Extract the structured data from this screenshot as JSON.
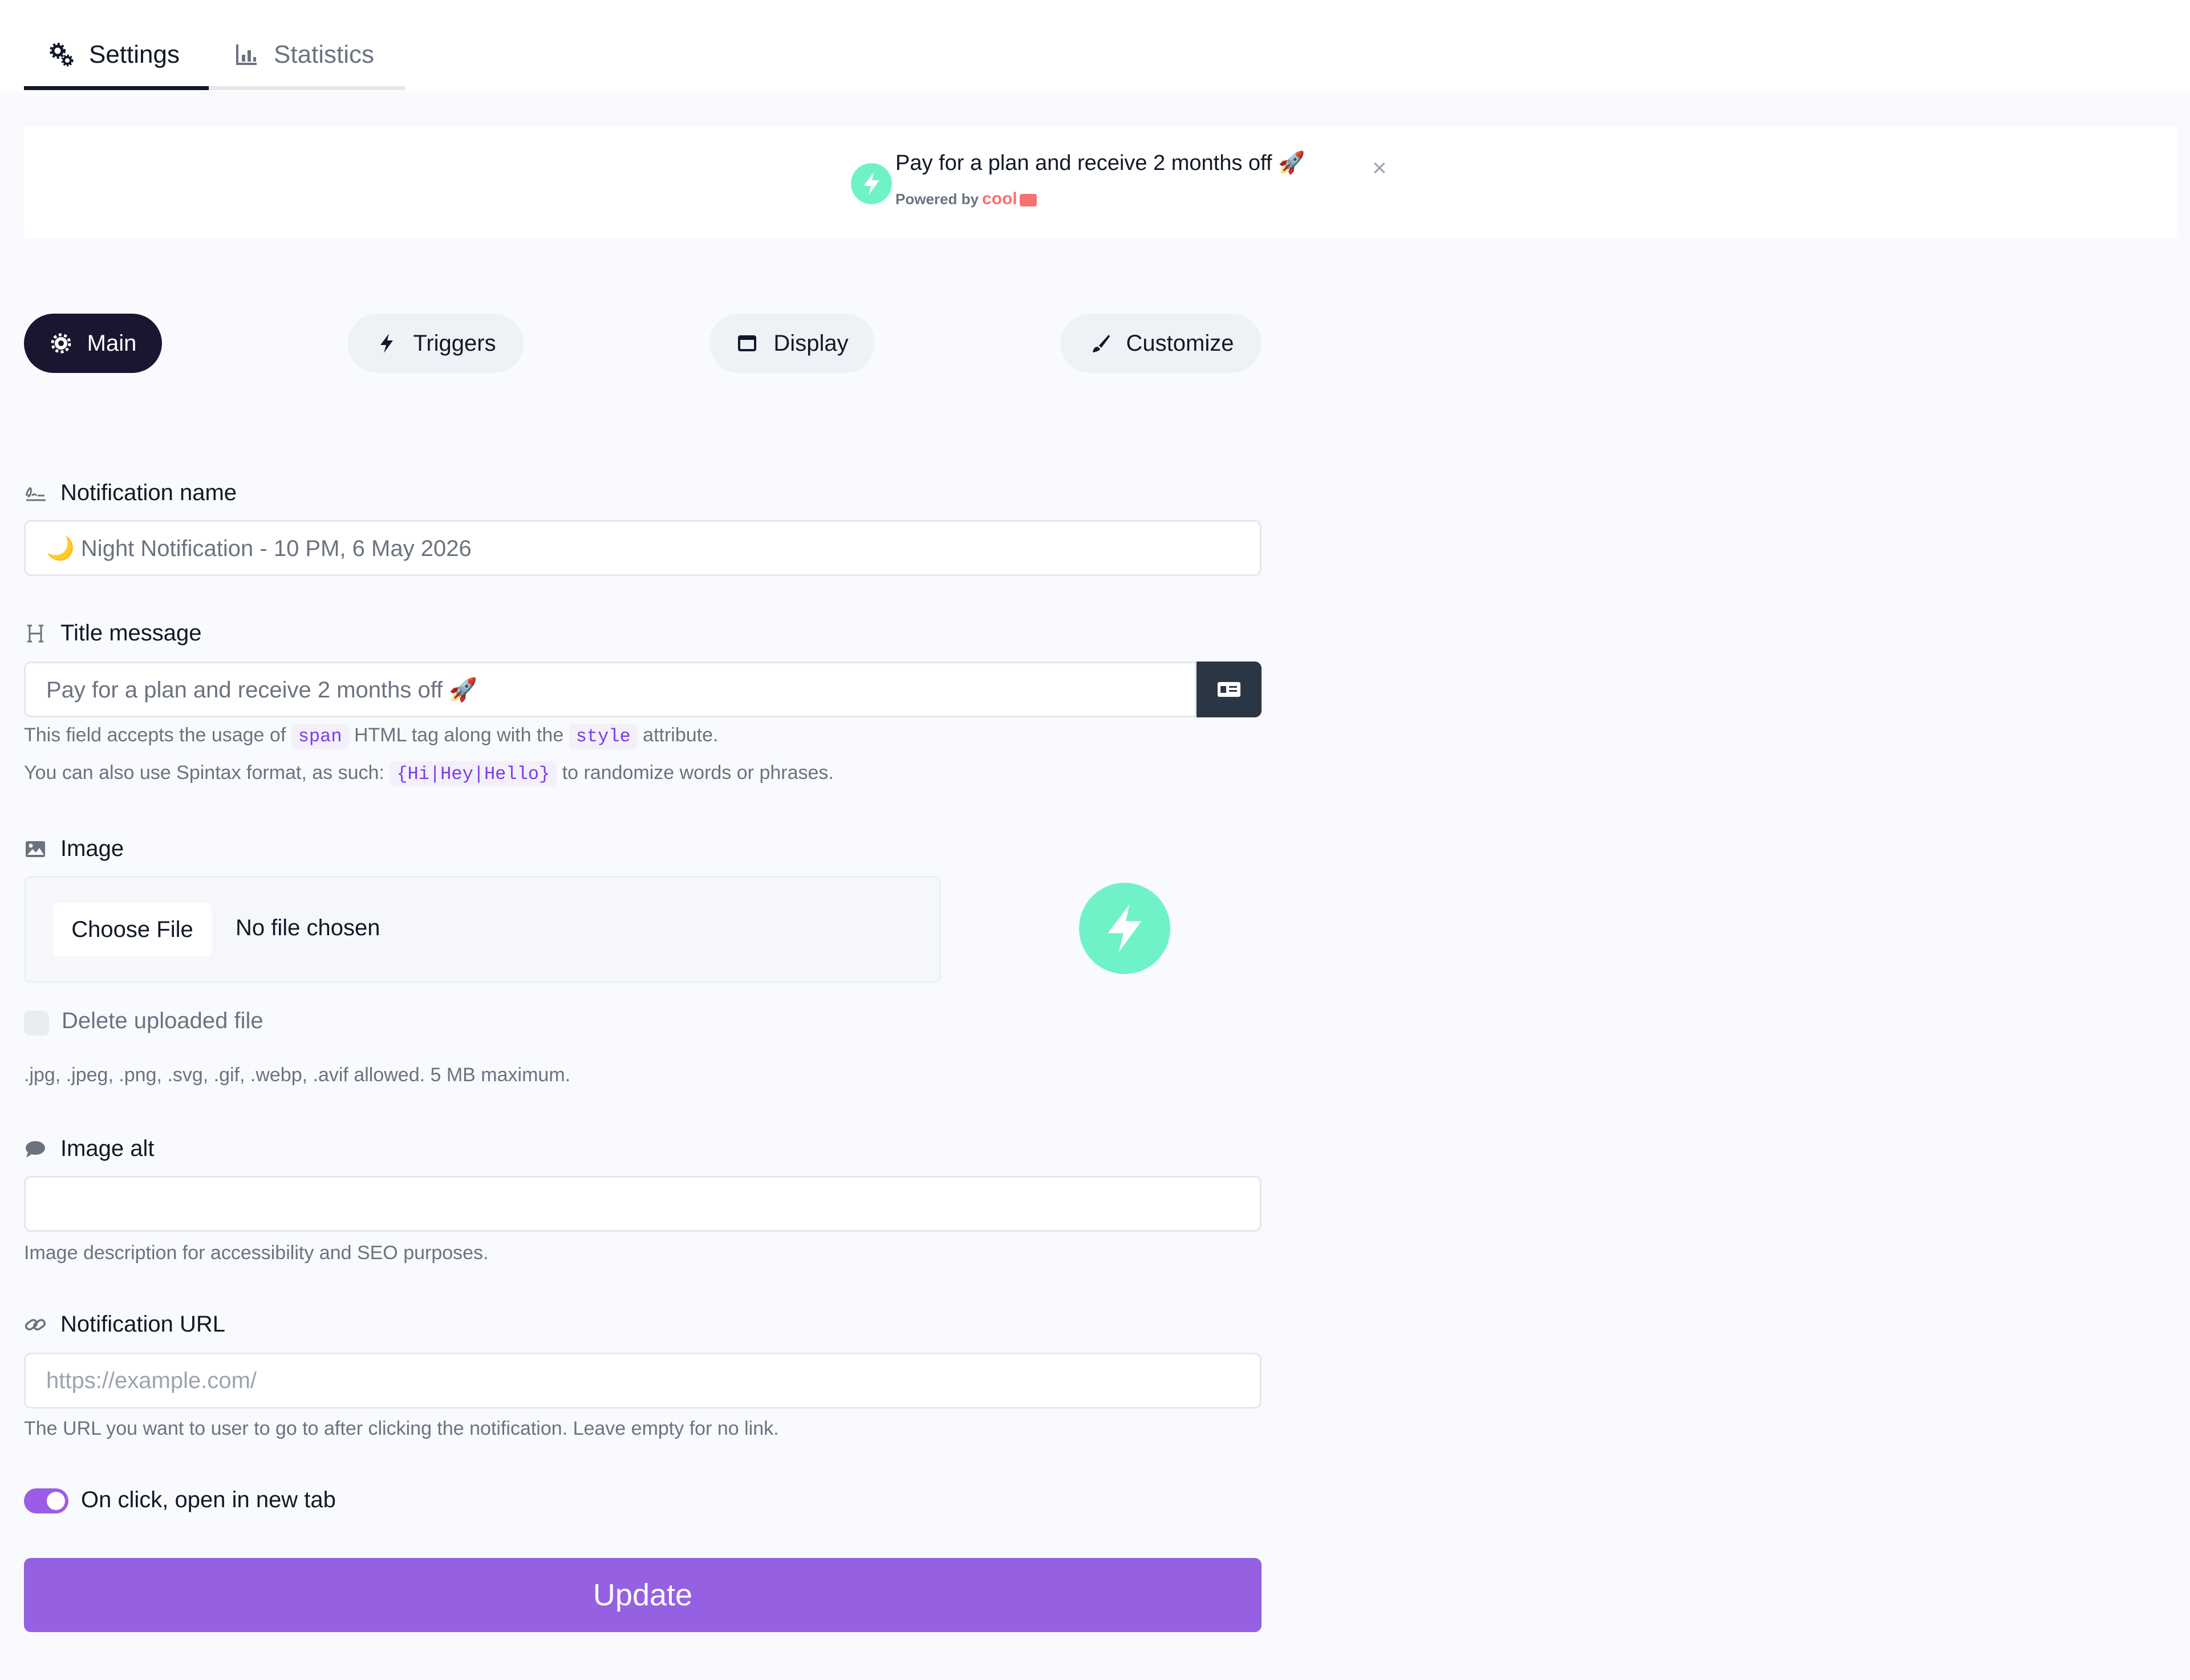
{
  "tabs": [
    {
      "label": "Settings",
      "icon": "gears-icon",
      "active": true
    },
    {
      "label": "Statistics",
      "icon": "bar-chart-icon",
      "active": false
    }
  ],
  "banner": {
    "title": "Pay for a plan and receive 2 months off 🚀",
    "powered_by": "Powered by",
    "brand": "cool",
    "close": "×",
    "logo_color": "#6ff2c8"
  },
  "section_tabs": [
    {
      "label": "Main",
      "icon": "gear-icon",
      "active": true
    },
    {
      "label": "Triggers",
      "icon": "bolt-icon",
      "active": false
    },
    {
      "label": "Display",
      "icon": "window-icon",
      "active": false
    },
    {
      "label": "Customize",
      "icon": "paintbrush-icon",
      "active": false
    }
  ],
  "form": {
    "notification_name": {
      "label": "Notification name",
      "value": "🌙 Night Notification - 10 PM, 6 May 2026"
    },
    "title_message": {
      "label": "Title message",
      "value": "Pay for a plan and receive 2 months off 🚀",
      "help1_a": "This field accepts the usage of",
      "help1_code1": "span",
      "help1_b": "HTML tag along with the",
      "help1_code2": "style",
      "help1_c": "attribute.",
      "help2_a": "You can also use Spintax format, as such:",
      "help2_code": "{Hi|Hey|Hello}",
      "help2_b": "to randomize words or phrases."
    },
    "image": {
      "label": "Image",
      "choose_file": "Choose File",
      "file_status": "No file chosen",
      "delete_label": "Delete uploaded file",
      "allowed": ".jpg, .jpeg, .png, .svg, .gif, .webp, .avif allowed. 5 MB maximum."
    },
    "image_alt": {
      "label": "Image alt",
      "value": "",
      "help": "Image description for accessibility and SEO purposes."
    },
    "notification_url": {
      "label": "Notification URL",
      "placeholder": "https://example.com/",
      "help": "The URL you want to user to go to after clicking the notification. Leave empty for no link."
    },
    "open_new_tab": {
      "label": "On click, open in new tab",
      "checked": true
    },
    "submit_label": "Update"
  },
  "colors": {
    "accent": "#9561e2",
    "dark": "#1c1530",
    "brand_green": "#6ff2c8",
    "brand_red": "#f87171"
  }
}
